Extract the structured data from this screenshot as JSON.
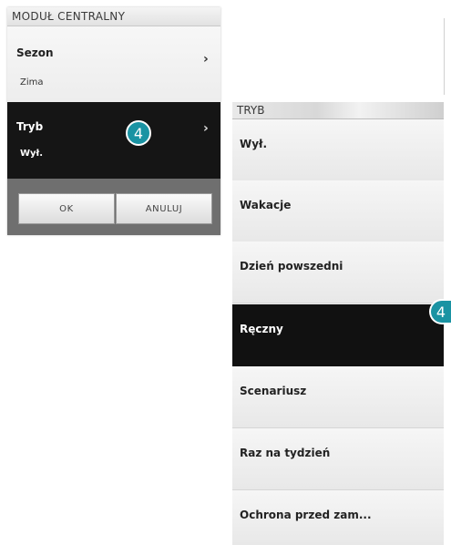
{
  "left_panel": {
    "header": "MODUŁ CENTRALNY",
    "season": {
      "label": "Sezon",
      "value": "Zima",
      "chevron": "›"
    },
    "mode": {
      "label": "Tryb",
      "value": "Wył.",
      "chevron": "›"
    },
    "buttons": {
      "ok": "OK",
      "cancel": "ANULUJ"
    }
  },
  "callouts": {
    "badge_left": "4",
    "badge_right": "4"
  },
  "right_panel": {
    "header": "TRYB",
    "items": [
      {
        "label": "Wył."
      },
      {
        "label": "Wakacje"
      },
      {
        "label": "Dzień powszedni"
      },
      {
        "label": "Ręczny",
        "selected": true
      },
      {
        "label": "Scenariusz"
      },
      {
        "label": "Raz na tydzień"
      },
      {
        "label": "Ochrona przed zam..."
      }
    ]
  },
  "colors": {
    "accent_badge": "#1a93a3",
    "selected_bg": "#111111"
  }
}
